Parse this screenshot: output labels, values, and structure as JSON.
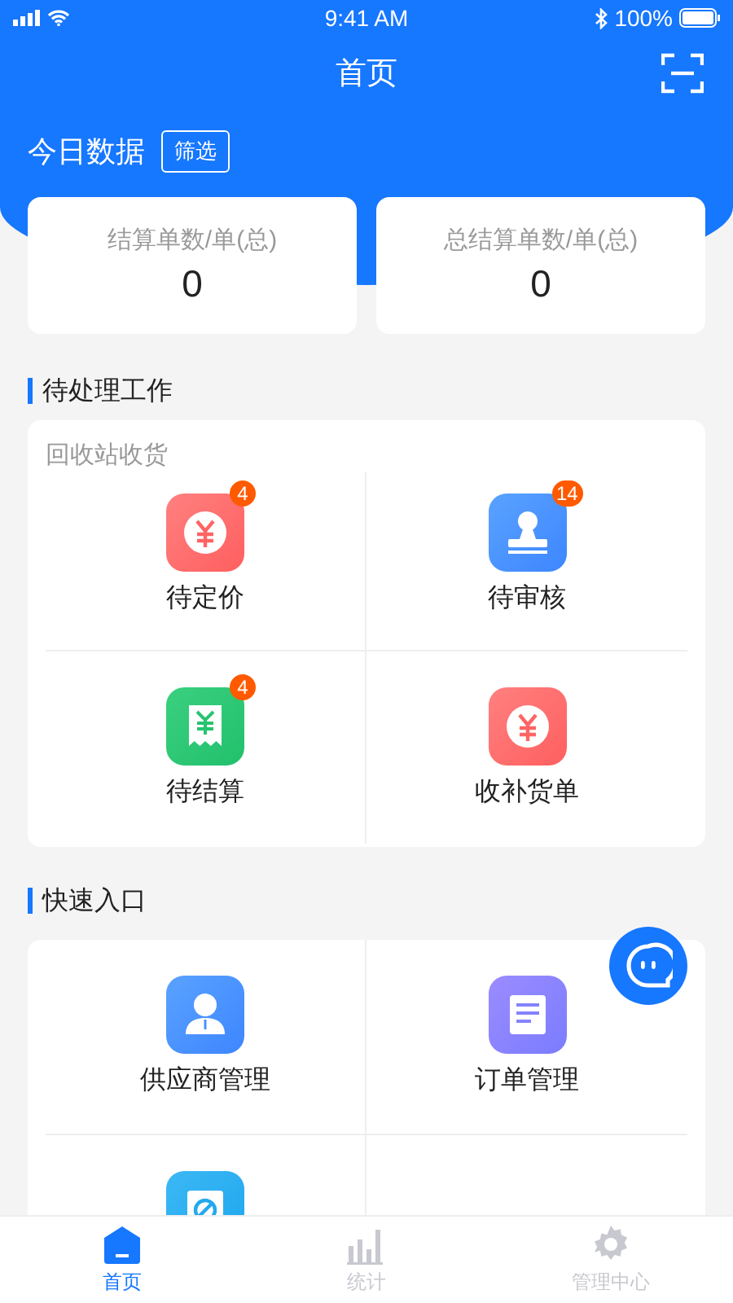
{
  "status_bar": {
    "time": "9:41 AM",
    "battery": "100%"
  },
  "nav": {
    "title": "首页"
  },
  "today": {
    "title": "今日数据",
    "filter_button": "筛选"
  },
  "stats": [
    {
      "label": "结算单数/单(总)",
      "value": "0"
    },
    {
      "label": "总结算单数/单(总)",
      "value": "0"
    }
  ],
  "pending": {
    "title": "待处理工作",
    "subtitle": "回收站收货",
    "items": [
      {
        "label": "待定价",
        "kind": "yuan",
        "badge": "4"
      },
      {
        "label": "待审核",
        "kind": "stamp",
        "badge": "14"
      },
      {
        "label": "待结算",
        "kind": "receipt",
        "badge": "4"
      },
      {
        "label": "收补货单",
        "kind": "yuan"
      }
    ]
  },
  "quick": {
    "title": "快速入口",
    "items": [
      {
        "label": "供应商管理",
        "kind": "person"
      },
      {
        "label": "订单管理",
        "kind": "document"
      },
      {
        "kind": "forbid"
      }
    ]
  },
  "tabs": [
    {
      "label": "首页",
      "kind": "home",
      "selected": true
    },
    {
      "label": "统计",
      "kind": "chart",
      "selected": false
    },
    {
      "label": "管理中心",
      "kind": "gear",
      "selected": false
    }
  ]
}
